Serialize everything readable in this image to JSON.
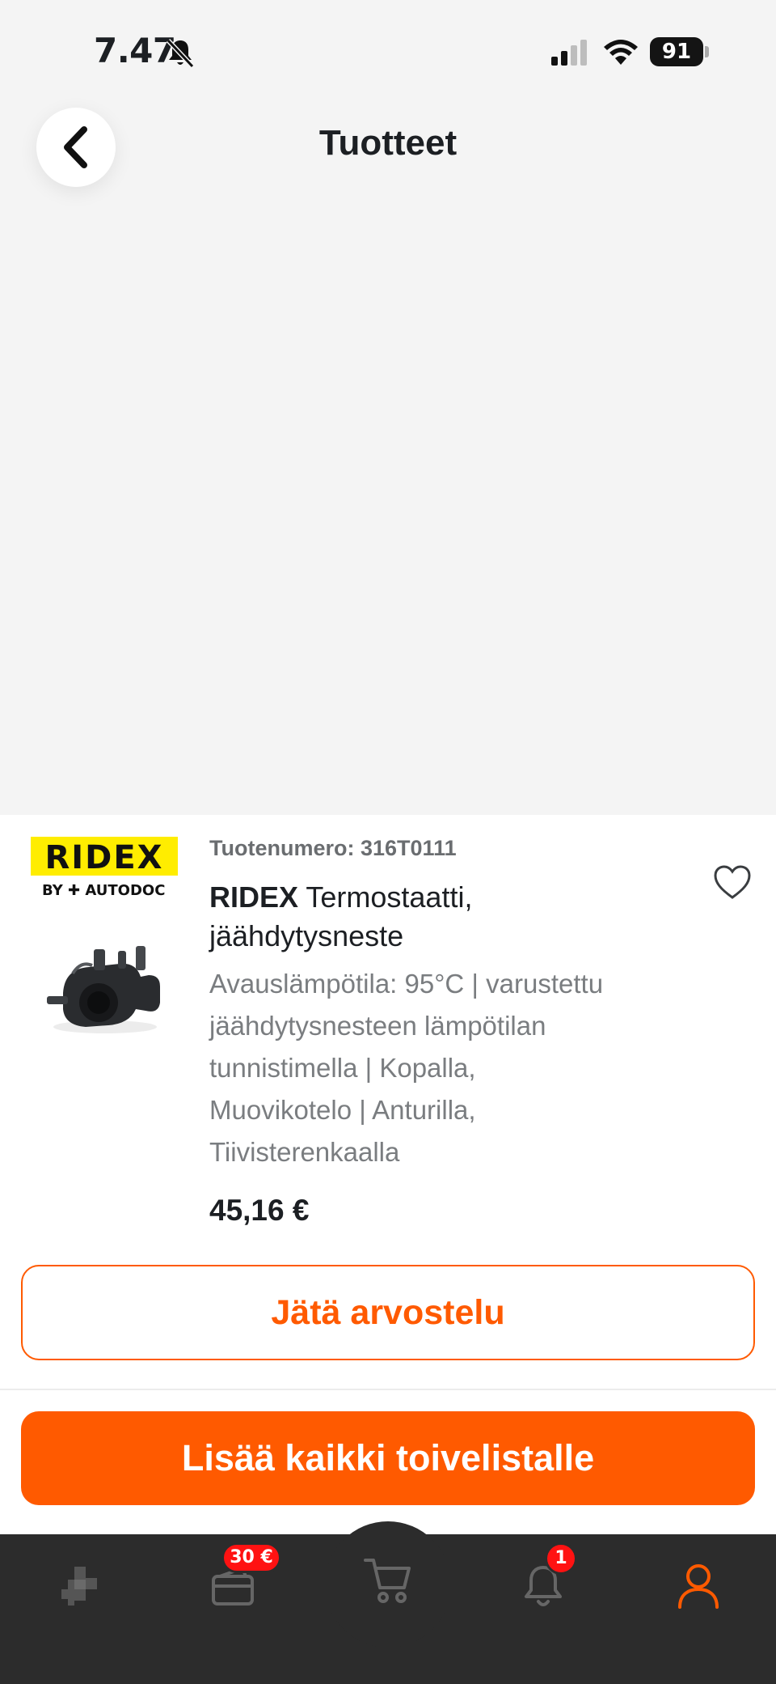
{
  "status_bar": {
    "time": "7.47",
    "battery": "91"
  },
  "header": {
    "title": "Tuotteet"
  },
  "product": {
    "brand_logo": {
      "name": "RIDEX",
      "sub": "BY ✚ AUTODOC"
    },
    "part_number": "Tuotenumero: 316T0111",
    "brand": "RIDEX",
    "title": " Termostaatti, jäähdytysneste",
    "description_lines": [
      "Avauslämpötila: 95°C | varustettu",
      "jäähdytysnesteen lämpötilan",
      "tunnistimella | Kopalla,",
      "Muovikotelo | Anturilla,",
      "Tiivisterenkaalla"
    ],
    "price": "45,16 €",
    "review_label": "Jätä arvostelu"
  },
  "actions": {
    "wishlist_label": "Lisää kaikki toivelistalle"
  },
  "tab_bar": {
    "wallet_badge": "30 €",
    "notifications_badge": "1"
  },
  "colors": {
    "accent": "#ff5a00",
    "brand_yellow": "#ffed00",
    "badge": "#ff1212",
    "tab_bar": "#2c2c2c",
    "background": "#f4f4f4"
  }
}
